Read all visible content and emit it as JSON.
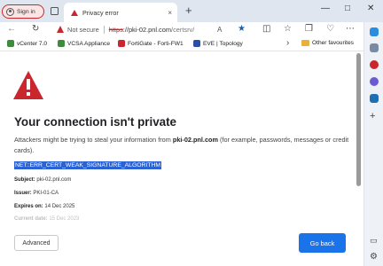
{
  "titlebar": {
    "signin_label": "Sign in",
    "tab_title": "Privacy error",
    "tab_close": "×",
    "new_tab": "+",
    "window_buttons": [
      "—",
      "□",
      "✕"
    ]
  },
  "navbar": {
    "back": "←",
    "refresh": "↻",
    "security_label": "Not secure",
    "url_scheme": "https",
    "url_host": "://pki-02.pnl.com",
    "url_path": "/certsrv/",
    "more": "⋯"
  },
  "favourites": {
    "items": [
      {
        "label": "vCenter 7.0",
        "color": "#3c8c3c"
      },
      {
        "label": "VCSA Appliance",
        "color": "#3c8c3c"
      },
      {
        "label": "FortiGate - Forti-FW1",
        "color": "#c9272d"
      },
      {
        "label": "EVE | Topology",
        "color": "#2b4fa8"
      }
    ],
    "overflow": "›",
    "other_label": "Other favourites"
  },
  "page": {
    "heading": "Your connection isn't private",
    "description_before": "Attackers might be trying to steal your information from ",
    "description_host": "pki-02.pnl.com",
    "description_after": " (for example, passwords, messages or credit cards).",
    "error_code": "NET::ERR_CERT_WEAK_SIGNATURE_ALGORITHM",
    "details": [
      {
        "key": "Subject:",
        "value": " pki-02.pnl.com"
      },
      {
        "key": "Issuer:",
        "value": " PKI-01-CA"
      },
      {
        "key": "Expires on:",
        "value": " 14 Dec 2025"
      },
      {
        "key": "Current date:",
        "value": " 15 Dec 2023"
      }
    ],
    "advanced_label": "Advanced",
    "go_back_label": "Go back"
  },
  "colors": {
    "accent": "#1a73e8",
    "danger": "#c9272d",
    "selection": "#2b62d4"
  }
}
